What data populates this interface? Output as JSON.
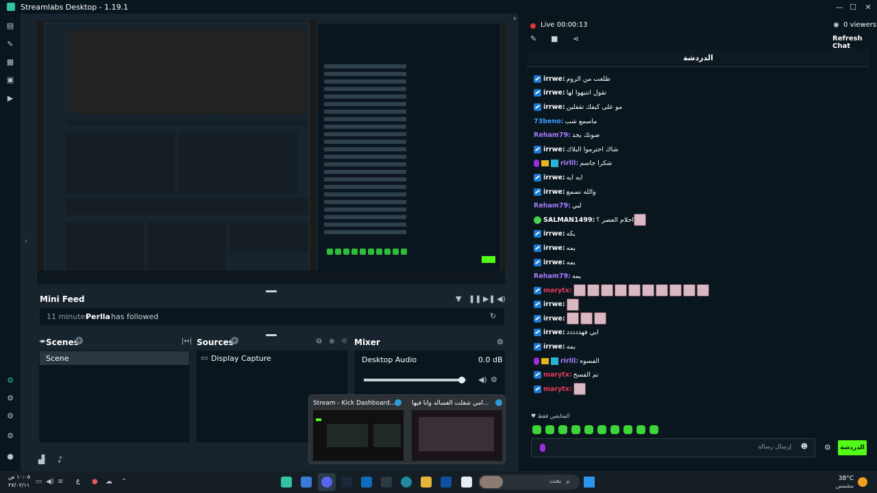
{
  "window": {
    "title": "Streamlabs Desktop - 1.19.1"
  },
  "colors": {
    "accent": "#31c3a2",
    "kick_green": "#53fc18",
    "live_red": "#e0333b",
    "purple": "#9d7cff",
    "red_user": "#e53a5a"
  },
  "mini_feed": {
    "title": "Mini Feed",
    "time": "11 minutes",
    "user": "Perlla",
    "action": "has followed"
  },
  "scenes": {
    "title": "Scenes",
    "items": [
      "Scene"
    ]
  },
  "sources": {
    "title": "Sources",
    "items": [
      "Display Capture"
    ]
  },
  "mixer": {
    "title": "Mixer",
    "items": [
      {
        "name": "Desktop Audio",
        "level": "0.0 dB",
        "volume_fraction": 0.95
      }
    ]
  },
  "chat": {
    "status": "Live 00:00:13",
    "viewers": "0 viewers",
    "refresh": "Refresh Chat",
    "tab": "الدردشة",
    "messages": [
      {
        "user": "irrwe:",
        "text": "طلعت من الروم",
        "color": "#ffffff",
        "badges": [
          "kick"
        ],
        "emotes": 0
      },
      {
        "user": "irrwe:",
        "text": "تقول انتبهوا لها",
        "color": "#ffffff",
        "badges": [
          "kick"
        ],
        "emotes": 0
      },
      {
        "user": "irrwe:",
        "text": "مو على كيفك تقفلين",
        "color": "#ffffff",
        "badges": [
          "kick"
        ],
        "emotes": 0
      },
      {
        "user": "73beno:",
        "text": "ماسمع شب",
        "color": "#3b9bff",
        "badges": [],
        "emotes": 0
      },
      {
        "user": "Reham79:",
        "text": "صوتك يجد",
        "color": "#a97cff",
        "badges": [],
        "emotes": 0
      },
      {
        "user": "irrwe:",
        "text": "شاك احترموا البلاك",
        "color": "#ffffff",
        "badges": [
          "kick"
        ],
        "emotes": 0
      },
      {
        "user": "rirlll:",
        "text": "شكرا جاسم",
        "color": "#a97cff",
        "badges": [
          "mic",
          "crown",
          "gift"
        ],
        "emotes": 0
      },
      {
        "user": "irrwe:",
        "text": "ايه ايه",
        "color": "#ffffff",
        "badges": [
          "kick"
        ],
        "emotes": 0
      },
      {
        "user": "irrwe:",
        "text": "والله نسمع",
        "color": "#ffffff",
        "badges": [
          "kick"
        ],
        "emotes": 0
      },
      {
        "user": "Reham79:",
        "text": "لبي",
        "color": "#a97cff",
        "badges": [],
        "emotes": 0
      },
      {
        "user": "SALMAN1499:",
        "text": "احلام العصر ؟",
        "color": "#ffffff",
        "badges": [
          "verified"
        ],
        "emotes": 1
      },
      {
        "user": "irrwe:",
        "text": "يكه",
        "color": "#ffffff",
        "badges": [
          "kick"
        ],
        "emotes": 0
      },
      {
        "user": "irrwe:",
        "text": "يمه",
        "color": "#ffffff",
        "badges": [
          "kick"
        ],
        "emotes": 0
      },
      {
        "user": "irrwe:",
        "text": "يمه",
        "color": "#ffffff",
        "badges": [
          "kick"
        ],
        "emotes": 0
      },
      {
        "user": "Reham79:",
        "text": "يمه",
        "color": "#a97cff",
        "badges": [],
        "emotes": 0
      },
      {
        "user": "marytx:",
        "text": "",
        "color": "#e53a5a",
        "badges": [
          "kick"
        ],
        "emotes": 10
      },
      {
        "user": "irrwe:",
        "text": "",
        "color": "#ffffff",
        "badges": [
          "kick"
        ],
        "emotes": 1
      },
      {
        "user": "irrwe:",
        "text": "",
        "color": "#ffffff",
        "badges": [
          "kick"
        ],
        "emotes": 3
      },
      {
        "user": "irrwe:",
        "text": "ابي فهددددد",
        "color": "#ffffff",
        "badges": [
          "kick"
        ],
        "emotes": 0
      },
      {
        "user": "irrwe:",
        "text": "يمه",
        "color": "#ffffff",
        "badges": [
          "kick"
        ],
        "emotes": 0
      },
      {
        "user": "rirlll:",
        "text": "الفسوه",
        "color": "#a97cff",
        "badges": [
          "mic",
          "crown",
          "gift"
        ],
        "emotes": 0
      },
      {
        "user": "marytx:",
        "text": "تم الفسخ",
        "color": "#e53a5a",
        "badges": [
          "kick"
        ],
        "emotes": 0
      },
      {
        "user": "marytx:",
        "text": "",
        "color": "#e53a5a",
        "badges": [
          "kick"
        ],
        "emotes": 1
      }
    ],
    "followers_only": "المتابعين فقط",
    "input_placeholder": "إرسال رسالة",
    "send_label": "الدردشة"
  },
  "thumbnails": [
    {
      "title": "Stream - Kick Dashboard..."
    },
    {
      "title": "امي شغلت الغساله وانا فيها..."
    }
  ],
  "taskbar": {
    "time": "١٠:٠٥ ص",
    "date": "٢٧/٠٢/١١",
    "lang": "ع",
    "search": "بحث",
    "weather_temp": "38°C",
    "weather_text": "مشمس"
  }
}
